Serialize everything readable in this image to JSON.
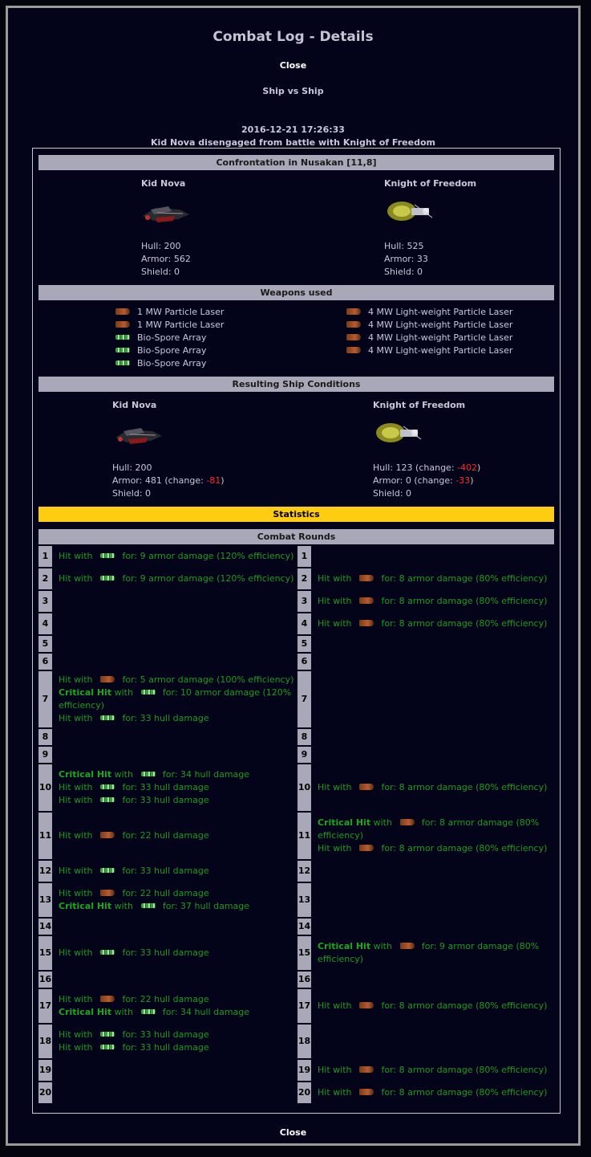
{
  "page": {
    "title": "Combat Log - Details",
    "close_label": "Close",
    "subtitle": "Ship vs Ship",
    "timestamp": "2016-12-21 17:26:33",
    "summary": "Kid Nova disengaged from battle with Knight of Freedom"
  },
  "confrontation": {
    "heading": "Confrontation in Nusakan [11,8]",
    "left": {
      "name": "Kid Nova",
      "hull": "Hull: 200",
      "armor": "Armor: 562",
      "shield": "Shield: 0"
    },
    "right": {
      "name": "Knight of Freedom",
      "hull": "Hull: 525",
      "armor": "Armor: 33",
      "shield": "Shield: 0"
    }
  },
  "weapons": {
    "heading": "Weapons used",
    "left": [
      {
        "label": "1 MW Particle Laser",
        "icon": "laser-icon"
      },
      {
        "label": "1 MW Particle Laser",
        "icon": "laser-icon"
      },
      {
        "label": "Bio-Spore Array",
        "icon": "bio-spore-icon"
      },
      {
        "label": "Bio-Spore Array",
        "icon": "bio-spore-icon"
      },
      {
        "label": "Bio-Spore Array",
        "icon": "bio-spore-icon"
      }
    ],
    "right": [
      {
        "label": "4 MW Light-weight Particle Laser",
        "icon": "laser-icon"
      },
      {
        "label": "4 MW Light-weight Particle Laser",
        "icon": "laser-icon"
      },
      {
        "label": "4 MW Light-weight Particle Laser",
        "icon": "laser-icon"
      },
      {
        "label": "4 MW Light-weight Particle Laser",
        "icon": "laser-icon"
      }
    ]
  },
  "result": {
    "heading": "Resulting Ship Conditions",
    "left": {
      "name": "Kid Nova",
      "hull": "Hull: 200",
      "armor_pre": "Armor: 481 (change: ",
      "armor_change": "-81",
      "armor_post": ")",
      "shield": "Shield: 0"
    },
    "right": {
      "name": "Knight of Freedom",
      "hull_pre": "Hull: 123 (change: ",
      "hull_change": "-402",
      "hull_post": ")",
      "armor_pre": "Armor: 0 (change: ",
      "armor_change": "-33",
      "armor_post": ")",
      "shield": "Shield: 0"
    }
  },
  "statistics_label": "Statistics",
  "rounds_heading": "Combat Rounds",
  "rounds": {
    "1": {
      "left": [
        "H|bio|for: 9 armor damage (120% efficiency)"
      ],
      "right": []
    },
    "2": {
      "left": [
        "H|bio|for: 9 armor damage (120% efficiency)"
      ],
      "right": [
        "H|laser|for: 8 armor damage (80% efficiency)"
      ]
    },
    "3": {
      "left": [],
      "right": [
        "H|laser|for: 8 armor damage (80% efficiency)"
      ]
    },
    "4": {
      "left": [],
      "right": [
        "H|laser|for: 8 armor damage (80% efficiency)"
      ]
    },
    "5": {
      "left": [],
      "right": []
    },
    "6": {
      "left": [],
      "right": []
    },
    "7": {
      "left": [
        "H|laser|for: 5 armor damage (100% efficiency)",
        "C|bio|for: 10 armor damage (120%|efficiency)",
        "H|bio|for: 33 hull damage"
      ],
      "right": []
    },
    "8": {
      "left": [],
      "right": []
    },
    "9": {
      "left": [],
      "right": []
    },
    "10": {
      "left": [
        "C|bio|for: 34 hull damage",
        "H|bio|for: 33 hull damage",
        "H|bio|for: 33 hull damage"
      ],
      "right": [
        "H|laser|for: 8 armor damage (80% efficiency)"
      ]
    },
    "11": {
      "left": [
        "H|laser|for: 22 hull damage"
      ],
      "right": [
        "C|laser|for: 8 armor damage (80%|efficiency)",
        "H|laser|for: 8 armor damage (80% efficiency)"
      ]
    },
    "12": {
      "left": [
        "H|bio|for: 33 hull damage"
      ],
      "right": []
    },
    "13": {
      "left": [
        "H|laser|for: 22 hull damage",
        "C|bio|for: 37 hull damage"
      ],
      "right": []
    },
    "14": {
      "left": [],
      "right": []
    },
    "15": {
      "left": [
        "H|bio|for: 33 hull damage"
      ],
      "right": [
        "C|laser|for: 9 armor damage (80%|efficiency)"
      ]
    },
    "16": {
      "left": [],
      "right": []
    },
    "17": {
      "left": [
        "H|laser|for: 22 hull damage",
        "C|bio|for: 34 hull damage"
      ],
      "right": [
        "H|laser|for: 8 armor damage (80% efficiency)"
      ]
    },
    "18": {
      "left": [
        "H|bio|for: 33 hull damage",
        "H|bio|for: 33 hull damage"
      ],
      "right": []
    },
    "19": {
      "left": [],
      "right": [
        "H|laser|for: 8 armor damage (80% efficiency)"
      ]
    },
    "20": {
      "left": [],
      "right": [
        "H|laser|for: 8 armor damage (80% efficiency)"
      ]
    }
  },
  "hit_labels": {
    "hit": "Hit with",
    "critical": "Critical Hit",
    "with": "with"
  },
  "colors": {
    "background": "#03041a",
    "header_bar": "#a8a8b8",
    "statistics_bar": "#ffcc14",
    "hit_text": "#1f9a1f",
    "change_text": "#ff2a2a"
  }
}
